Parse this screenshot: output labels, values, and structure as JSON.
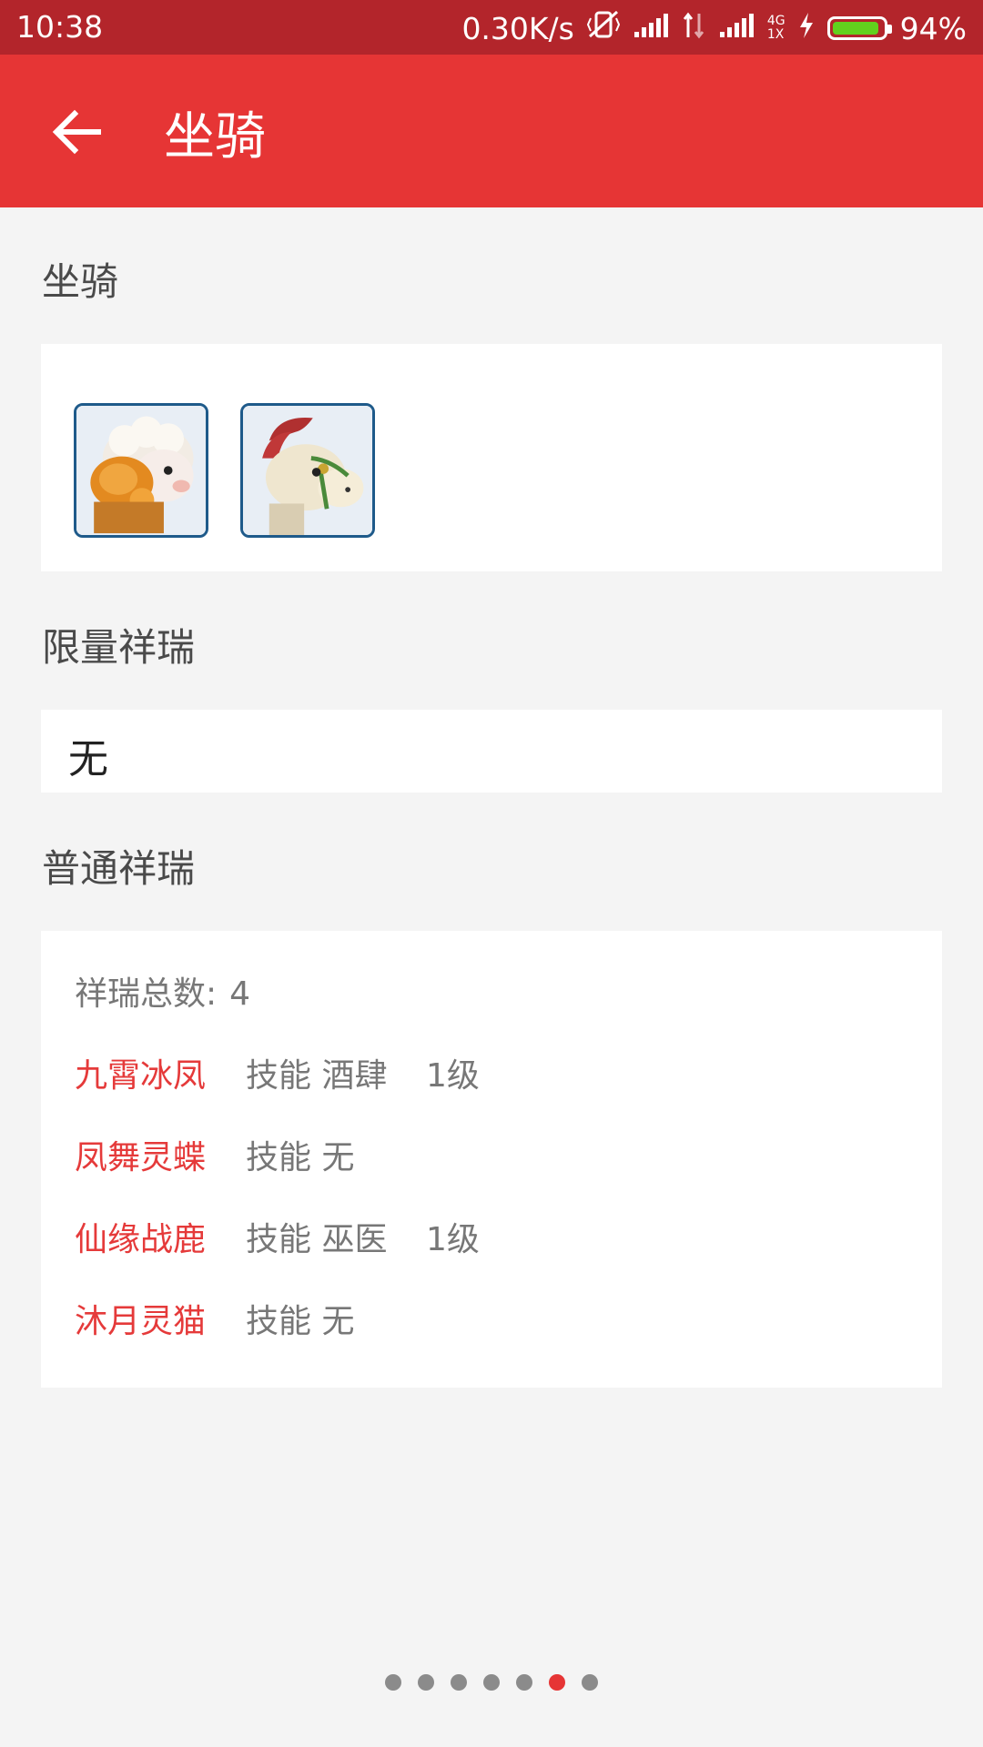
{
  "status_bar": {
    "time": "10:38",
    "net_speed": "0.30K/s",
    "network_label_top": "4G",
    "network_label_bottom": "1X",
    "battery_percent": "94%",
    "battery_level": 0.94,
    "battery_color": "#62d11d"
  },
  "toolbar": {
    "title": "坐骑",
    "back_icon": "arrow-left-icon",
    "color": "#e63535"
  },
  "mount_section": {
    "title": "坐骑",
    "icons": [
      "sheep-mount-icon",
      "horse-mount-icon"
    ]
  },
  "limited_section": {
    "title": "限量祥瑞",
    "value": "无"
  },
  "normal_section": {
    "title": "普通祥瑞",
    "total_label": "祥瑞总数:",
    "total_value": "4",
    "items": [
      {
        "name": "九霄冰凤",
        "skill": "技能 酒肆",
        "level": "1级"
      },
      {
        "name": "凤舞灵蝶",
        "skill": "技能 无",
        "level": ""
      },
      {
        "name": "仙缘战鹿",
        "skill": "技能 巫医",
        "level": "1级"
      },
      {
        "name": "沐月灵猫",
        "skill": "技能 无",
        "level": ""
      }
    ]
  },
  "pager": {
    "count": 7,
    "active_index": 5,
    "active_color": "#e63535"
  }
}
